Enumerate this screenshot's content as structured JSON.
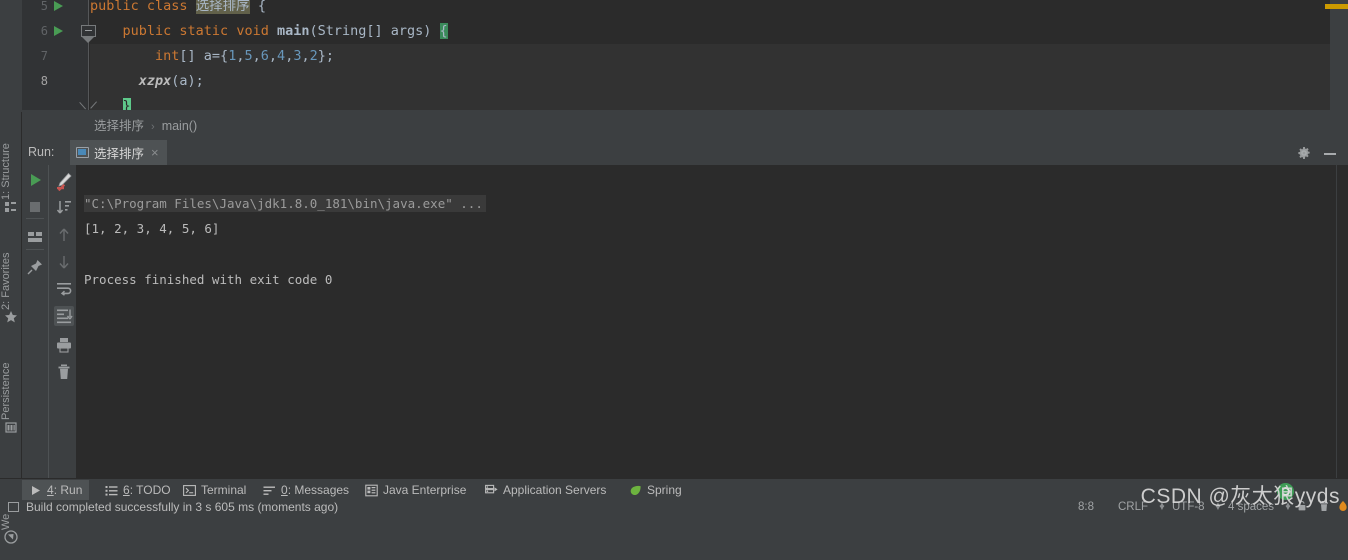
{
  "editor": {
    "lines": [
      {
        "num": "5",
        "run_marker": true,
        "fold": "minus-top",
        "current": false,
        "dim": false,
        "tokens": [
          {
            "t": "public ",
            "c": "kw"
          },
          {
            "t": "class ",
            "c": "kw"
          },
          {
            "t": "选择排序",
            "c": "sel"
          },
          {
            "t": " {",
            "c": "plain"
          }
        ]
      },
      {
        "num": "6",
        "run_marker": true,
        "fold": "minus",
        "current": false,
        "dim": false,
        "tokens": [
          {
            "t": "    public ",
            "c": "kw"
          },
          {
            "t": "static ",
            "c": "kw"
          },
          {
            "t": "void ",
            "c": "kw"
          },
          {
            "t": "main",
            "c": "bold"
          },
          {
            "t": "(String[] args) ",
            "c": "plain"
          },
          {
            "t": "{",
            "c": "brace-hl"
          }
        ]
      },
      {
        "num": "7",
        "run_marker": false,
        "fold": "rail",
        "current": false,
        "dim": true,
        "tokens": [
          {
            "t": "        ",
            "c": "plain"
          },
          {
            "t": "int",
            "c": "kw"
          },
          {
            "t": "[] a={",
            "c": "plain"
          },
          {
            "t": "1",
            "c": "num"
          },
          {
            "t": ",",
            "c": "plain"
          },
          {
            "t": "5",
            "c": "num"
          },
          {
            "t": ",",
            "c": "plain"
          },
          {
            "t": "6",
            "c": "num"
          },
          {
            "t": ",",
            "c": "plain"
          },
          {
            "t": "4",
            "c": "num"
          },
          {
            "t": ",",
            "c": "plain"
          },
          {
            "t": "3",
            "c": "num"
          },
          {
            "t": ",",
            "c": "plain"
          },
          {
            "t": "2",
            "c": "num"
          },
          {
            "t": "};",
            "c": "plain"
          }
        ]
      },
      {
        "num": "8",
        "run_marker": false,
        "fold": "rail",
        "current": true,
        "dim": false,
        "tokens": [
          {
            "t": "      ",
            "c": "plain"
          },
          {
            "t": "xzpx",
            "c": "italic"
          },
          {
            "t": "(a);",
            "c": "plain"
          }
        ]
      },
      {
        "num": "",
        "run_marker": false,
        "fold": "v",
        "current": false,
        "dim": true,
        "tokens": [
          {
            "t": "    ",
            "c": "plain"
          },
          {
            "t": "}",
            "c": "brace-hl2"
          }
        ]
      }
    ]
  },
  "breadcrumb": {
    "items": [
      "选择排序",
      "main()"
    ],
    "separator": "›"
  },
  "left_tool_strip": {
    "items": [
      {
        "label": "1: Structure",
        "icon": "structure-icon"
      },
      {
        "label": "2: Favorites",
        "icon": "star-icon"
      },
      {
        "label": "Persistence",
        "icon": "persistence-icon"
      },
      {
        "label": "Web",
        "icon": "web-icon"
      }
    ]
  },
  "run_panel": {
    "title": "Run:",
    "tab": {
      "label": "选择排序",
      "icon": "run-config-icon",
      "close": "×"
    },
    "settings_icon": "gear-icon",
    "minimize_icon": "minimize-icon",
    "toolbar_left": [
      {
        "name": "rerun-button",
        "icon": "play-icon",
        "enabled": true
      },
      {
        "name": "stop-button",
        "icon": "stop-icon",
        "enabled": false
      },
      {
        "name": "layout-button",
        "icon": "layout-icon",
        "enabled": true
      },
      {
        "name": "pin-button",
        "icon": "pin-icon",
        "enabled": true
      }
    ],
    "toolbar_right": [
      {
        "name": "rerun-failed-button",
        "icon": "pencil-icon",
        "enabled": true
      },
      {
        "name": "sort-button",
        "icon": "sort-desc-icon",
        "enabled": true
      },
      {
        "name": "prev-occurrence",
        "icon": "arrow-up-icon",
        "enabled": false
      },
      {
        "name": "next-occurrence",
        "icon": "arrow-down-icon",
        "enabled": false
      },
      {
        "name": "soft-wrap-button",
        "icon": "soft-wrap-icon",
        "enabled": true
      },
      {
        "name": "scroll-to-end-button",
        "icon": "scroll-end-icon",
        "enabled": true,
        "active": true
      },
      {
        "name": "print-button",
        "icon": "printer-icon",
        "enabled": true
      },
      {
        "name": "clear-all-button",
        "icon": "trash-icon",
        "enabled": true
      }
    ],
    "console": {
      "command": "\"C:\\Program Files\\Java\\jdk1.8.0_181\\bin\\java.exe\" ...",
      "output": [
        "[1, 2, 3, 4, 5, 6]",
        "",
        "",
        "Process finished with exit code 0"
      ]
    }
  },
  "toolwindow_bar": {
    "items": [
      {
        "label_pre": "",
        "accel": "4",
        "label": ": Run",
        "icon": "play-icon",
        "active": true
      },
      {
        "label_pre": "",
        "accel": "6",
        "label": ": TODO",
        "icon": "todo-icon",
        "active": false
      },
      {
        "label_pre": "",
        "accel": "",
        "label": "Terminal",
        "icon": "terminal-icon",
        "active": false
      },
      {
        "label_pre": "",
        "accel": "0",
        "label": ": Messages",
        "icon": "messages-icon",
        "active": false
      },
      {
        "label_pre": "",
        "accel": "",
        "label": "Java Enterprise",
        "icon": "java-ee-icon",
        "active": false
      },
      {
        "label_pre": "",
        "accel": "",
        "label": "Application Servers",
        "icon": "app-servers-icon",
        "active": false
      },
      {
        "label_pre": "",
        "accel": "",
        "label": "Spring",
        "icon": "spring-icon",
        "active": false
      }
    ]
  },
  "status_bar": {
    "build_message": "Build completed successfully in 3 s 605 ms (moments ago)",
    "caret_position": "8:8",
    "line_separator": "CRLF",
    "encoding": "UTF-8",
    "indent": "4 spaces",
    "lock_icon": "lock-icon",
    "trash_icon": "trash-icon"
  },
  "watermark": {
    "text": "CSDN @灰太狼yyds"
  },
  "colors": {
    "editor_bg": "#2b2b2b",
    "panel_bg": "#3c3f41",
    "gutter_bg": "#313335",
    "keyword": "#cc7832",
    "number": "#6897bb",
    "text": "#a9b7c6",
    "accent_green": "#499c54",
    "stripe_warning": "#cc9a00"
  }
}
